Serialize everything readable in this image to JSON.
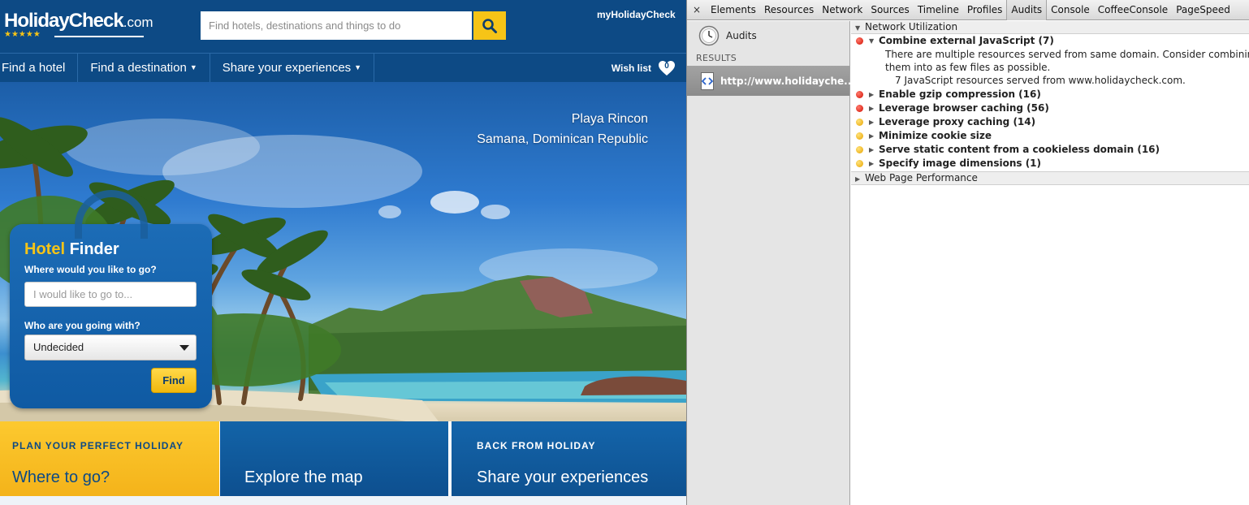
{
  "site": {
    "logo": {
      "name": "HolidayCheck",
      "tld": ".com",
      "stars": "★★★★★"
    },
    "search": {
      "placeholder": "Find hotels, destinations and things to do"
    },
    "account_link": "myHolidayCheck",
    "nav": [
      {
        "label": "Find a hotel",
        "dropdown": false
      },
      {
        "label": "Find a destination",
        "dropdown": true
      },
      {
        "label": "Share your experiences",
        "dropdown": true
      }
    ],
    "wishlist": {
      "label": "Wish list",
      "count": "0"
    },
    "hero": {
      "location_title": "Playa Rincon",
      "location_sub": "Samana, Dominican Republic"
    },
    "hotel_finder": {
      "title_accent": "Hotel",
      "title_rest": "Finder",
      "destination_label": "Where would you like to go?",
      "destination_placeholder": "I would like to go to...",
      "companion_label": "Who are you going with?",
      "companion_value": "Undecided",
      "submit_label": "Find"
    },
    "tiles": [
      {
        "kicker": "PLAN YOUR PERFECT HOLIDAY",
        "title": "Where to go?"
      },
      {
        "kicker": "",
        "title": "Explore the map"
      },
      {
        "kicker": "BACK FROM HOLIDAY",
        "title": "Share your experiences"
      }
    ],
    "colors": {
      "brand_blue": "#0d4a85",
      "accent_yellow": "#f6c417"
    }
  },
  "devtools": {
    "close_glyph": "×",
    "tabs": [
      "Elements",
      "Resources",
      "Network",
      "Sources",
      "Timeline",
      "Profiles",
      "Audits",
      "Console",
      "CoffeeConsole",
      "PageSpeed"
    ],
    "active_tab": "Audits",
    "sidebar": {
      "audits_label": "Audits",
      "results_heading": "RESULTS",
      "result_item": "http://www.holidayche..."
    },
    "sections": [
      {
        "title": "Network Utilization",
        "expanded": true,
        "rules": [
          {
            "title": "Combine external JavaScript (7)",
            "severity": "red",
            "expanded": true,
            "description": [
              "There are multiple resources served from same domain. Consider combining",
              "them into as few files as possible."
            ],
            "detail": "7 JavaScript resources served from www.holidaycheck.com."
          },
          {
            "title": "Enable gzip compression (16)",
            "severity": "red",
            "expanded": false
          },
          {
            "title": "Leverage browser caching (56)",
            "severity": "red",
            "expanded": false
          },
          {
            "title": "Leverage proxy caching (14)",
            "severity": "yellow",
            "expanded": false
          },
          {
            "title": "Minimize cookie size",
            "severity": "yellow",
            "expanded": false
          },
          {
            "title": "Serve static content from a cookieless domain (16)",
            "severity": "yellow",
            "expanded": false
          },
          {
            "title": "Specify image dimensions (1)",
            "severity": "yellow",
            "expanded": false
          }
        ]
      },
      {
        "title": "Web Page Performance",
        "expanded": false,
        "rules": []
      }
    ],
    "colors": {
      "severity_red": "#d20e00",
      "severity_yellow": "#e8a400"
    }
  }
}
